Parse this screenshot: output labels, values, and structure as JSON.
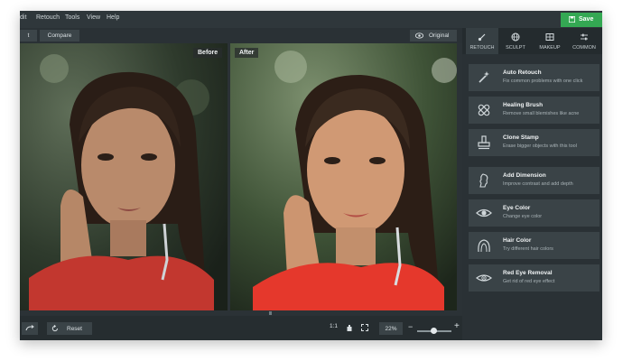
{
  "menu": [
    "dit",
    "Retouch",
    "Tools",
    "View",
    "Help"
  ],
  "save_label": "Save",
  "toolbar": {
    "left_label": "t",
    "compare_label": "Compare",
    "original_label": "Original"
  },
  "tabs": [
    {
      "label": "RETOUCH",
      "icon": "brush-icon",
      "active": true
    },
    {
      "label": "SCULPT",
      "icon": "globe-icon",
      "active": false
    },
    {
      "label": "MAKEUP",
      "icon": "palette-icon",
      "active": false
    },
    {
      "label": "COMMON",
      "icon": "sliders-icon",
      "active": false
    }
  ],
  "image": {
    "before_label": "Before",
    "after_label": "After"
  },
  "tools": [
    {
      "title": "Auto Retouch",
      "desc": "Fix common problems with one click",
      "icon": "auto-retouch-icon"
    },
    {
      "title": "Healing Brush",
      "desc": "Remove small blemishes like acne",
      "icon": "healing-brush-icon"
    },
    {
      "title": "Clone Stamp",
      "desc": "Erase bigger objects with this tool",
      "icon": "clone-stamp-icon"
    },
    {
      "title": "Add Dimension",
      "desc": "Improve contrast and add depth",
      "icon": "add-dimension-icon"
    },
    {
      "title": "Eye Color",
      "desc": "Change eye color",
      "icon": "eye-color-icon"
    },
    {
      "title": "Hair Color",
      "desc": "Try different hair colors",
      "icon": "hair-color-icon"
    },
    {
      "title": "Red Eye Removal",
      "desc": "Get rid of red eye effect",
      "icon": "red-eye-icon"
    }
  ],
  "bottom": {
    "reset_label": "Reset",
    "ratio_label": "1:1",
    "zoom_value": "22%",
    "zoom_minus": "−",
    "zoom_plus": "+"
  },
  "colors": {
    "accent": "#34a853",
    "panel": "#2a3135",
    "tool_bg": "#3a4347"
  }
}
